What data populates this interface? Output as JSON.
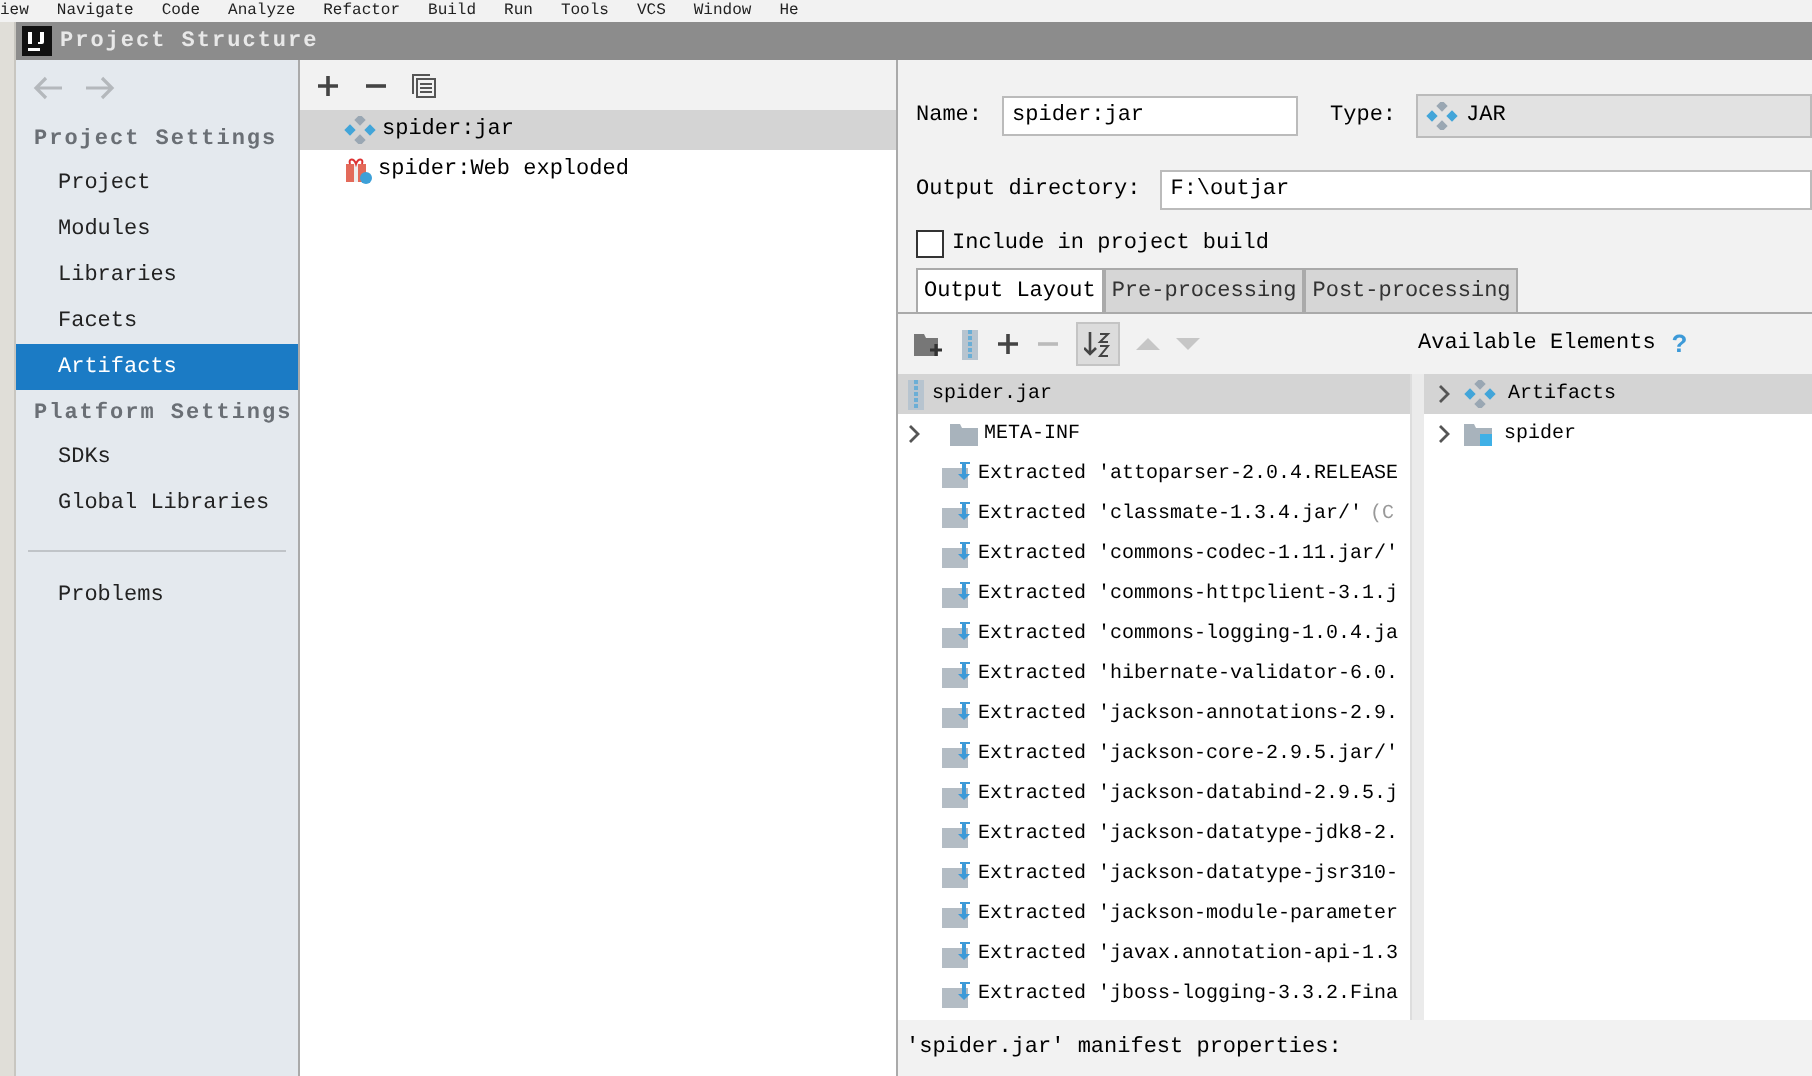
{
  "menu_bar": {
    "items": [
      "iew",
      "Navigate",
      "Code",
      "Analyze",
      "Refactor",
      "Build",
      "Run",
      "Tools",
      "VCS",
      "Window",
      "He"
    ]
  },
  "dialog": {
    "title": "Project Structure"
  },
  "sidebar": {
    "sections": [
      {
        "heading": "Project Settings",
        "items": [
          {
            "label": "Project",
            "selected": false
          },
          {
            "label": "Modules",
            "selected": false
          },
          {
            "label": "Libraries",
            "selected": false
          },
          {
            "label": "Facets",
            "selected": false
          },
          {
            "label": "Artifacts",
            "selected": true
          }
        ]
      },
      {
        "heading": "Platform Settings",
        "items": [
          {
            "label": "SDKs",
            "selected": false
          },
          {
            "label": "Global Libraries",
            "selected": false
          }
        ]
      }
    ],
    "footer_items": [
      {
        "label": "Problems",
        "selected": false
      }
    ]
  },
  "artifacts": [
    {
      "label": "spider:jar",
      "kind": "jar",
      "selected": true
    },
    {
      "label": "spider:Web exploded",
      "kind": "web",
      "selected": false
    }
  ],
  "form": {
    "name_label": "Name:",
    "name_value": "spider:jar",
    "type_label": "Type:",
    "type_value": "JAR",
    "output_label": "Output directory:",
    "output_value": "F:\\outjar",
    "include": {
      "label": "Include in project build",
      "checked": false
    }
  },
  "tabs": [
    {
      "label": "Output Layout",
      "selected": true
    },
    {
      "label": "Pre-processing",
      "selected": false
    },
    {
      "label": "Post-processing",
      "selected": false
    }
  ],
  "layout_tree": {
    "root": {
      "label": "spider.jar",
      "selected": true
    },
    "items": [
      {
        "label": "META-INF",
        "kind": "folder"
      },
      {
        "label": "Extracted 'attoparser-2.0.4.RELEASE",
        "kind": "extracted"
      },
      {
        "label": "Extracted 'classmate-1.3.4.jar/'",
        "kind": "extracted",
        "detail": "(C"
      },
      {
        "label": "Extracted 'commons-codec-1.11.jar/'",
        "kind": "extracted"
      },
      {
        "label": "Extracted 'commons-httpclient-3.1.j",
        "kind": "extracted"
      },
      {
        "label": "Extracted 'commons-logging-1.0.4.ja",
        "kind": "extracted"
      },
      {
        "label": "Extracted 'hibernate-validator-6.0.",
        "kind": "extracted"
      },
      {
        "label": "Extracted 'jackson-annotations-2.9.",
        "kind": "extracted"
      },
      {
        "label": "Extracted 'jackson-core-2.9.5.jar/'",
        "kind": "extracted"
      },
      {
        "label": "Extracted 'jackson-databind-2.9.5.j",
        "kind": "extracted"
      },
      {
        "label": "Extracted 'jackson-datatype-jdk8-2.",
        "kind": "extracted"
      },
      {
        "label": "Extracted 'jackson-datatype-jsr310-",
        "kind": "extracted"
      },
      {
        "label": "Extracted 'jackson-module-parameter",
        "kind": "extracted"
      },
      {
        "label": "Extracted 'javax.annotation-api-1.3",
        "kind": "extracted"
      },
      {
        "label": "Extracted 'jboss-logging-3.3.2.Fina",
        "kind": "extracted"
      }
    ]
  },
  "available": {
    "heading": "Available Elements",
    "help": "?",
    "items": [
      {
        "label": "Artifacts",
        "kind": "jar",
        "selected": true
      },
      {
        "label": "spider",
        "kind": "module",
        "selected": false
      }
    ]
  },
  "manifest_label": "'spider.jar' manifest properties:"
}
